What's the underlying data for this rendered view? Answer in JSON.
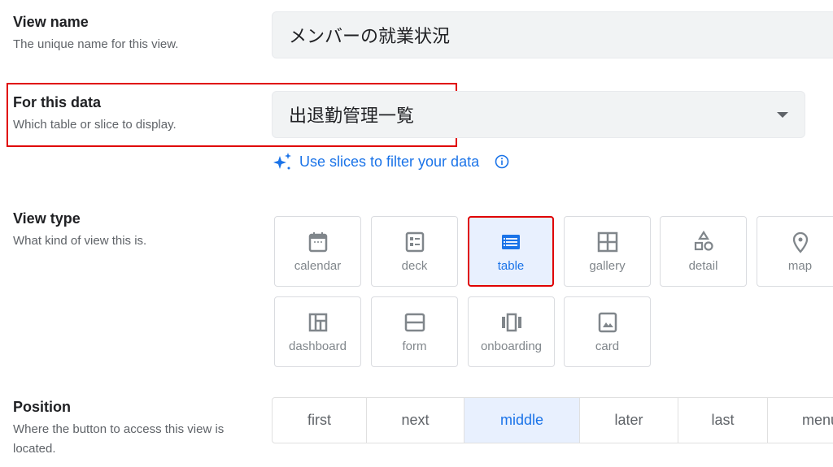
{
  "view_name": {
    "label": "View name",
    "description": "The unique name for this view.",
    "value": "メンバーの就業状況"
  },
  "for_this_data": {
    "label": "For this data",
    "description": "Which table or slice to display.",
    "value": "出退勤管理一覧",
    "slices_link": "Use slices to filter your data"
  },
  "view_type": {
    "label": "View type",
    "description": "What kind of view this is.",
    "selected": "table",
    "options": [
      {
        "label": "calendar",
        "icon": "calendar-icon"
      },
      {
        "label": "deck",
        "icon": "deck-icon"
      },
      {
        "label": "table",
        "icon": "table-icon"
      },
      {
        "label": "gallery",
        "icon": "gallery-icon"
      },
      {
        "label": "detail",
        "icon": "detail-icon"
      },
      {
        "label": "map",
        "icon": "map-pin-icon"
      },
      {
        "label": "dashboard",
        "icon": "dashboard-icon"
      },
      {
        "label": "form",
        "icon": "form-icon"
      },
      {
        "label": "onboarding",
        "icon": "onboarding-icon"
      },
      {
        "label": "card",
        "icon": "card-icon"
      }
    ]
  },
  "position": {
    "label": "Position",
    "description": "Where the button to access this view is located.",
    "selected": "middle",
    "options": [
      "first",
      "next",
      "middle",
      "later",
      "last",
      "menu"
    ]
  },
  "colors": {
    "accent": "#1a73e8",
    "highlight": "#e00000",
    "selected_bg": "#e8f0fe"
  }
}
